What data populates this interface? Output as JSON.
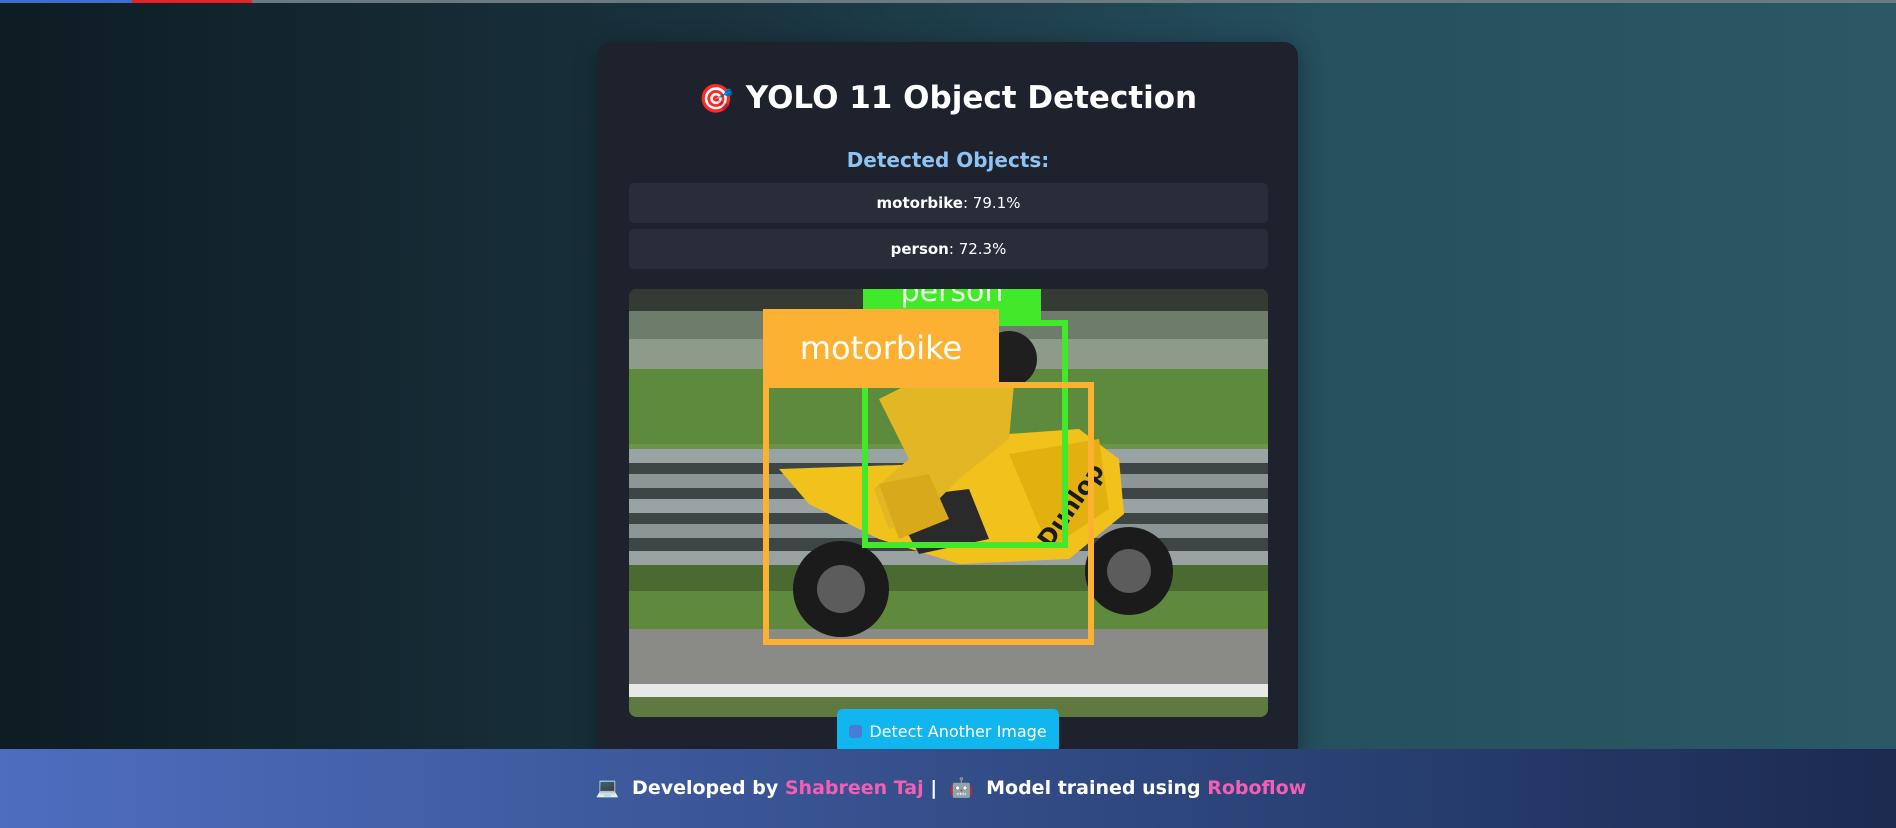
{
  "app": {
    "title": "YOLO 11 Object Detection",
    "title_icon": "🎯"
  },
  "results": {
    "heading": "Detected Objects:",
    "detections": [
      {
        "label": "motorbike",
        "confidence": "79.1%"
      },
      {
        "label": "person",
        "confidence": "72.3%"
      }
    ],
    "image_labels": {
      "person": "person",
      "motorbike": "motorbike",
      "rider_bib": "Dunlop"
    }
  },
  "actions": {
    "detect_again_label": "Detect Another Image"
  },
  "footer": {
    "laptop_icon": "💻",
    "developed_by": "Developed by",
    "developer_name": "Shabreen Taj",
    "separator": "|",
    "robot_icon": "🤖",
    "model_text": "Model trained using",
    "platform_name": "Roboflow"
  },
  "colors": {
    "accent": "#12b6ef",
    "person_box": "#42e82a",
    "motorbike_box": "#fdb133",
    "link_pink": "#f45fb4",
    "heading_blue": "#8fc3f2"
  }
}
